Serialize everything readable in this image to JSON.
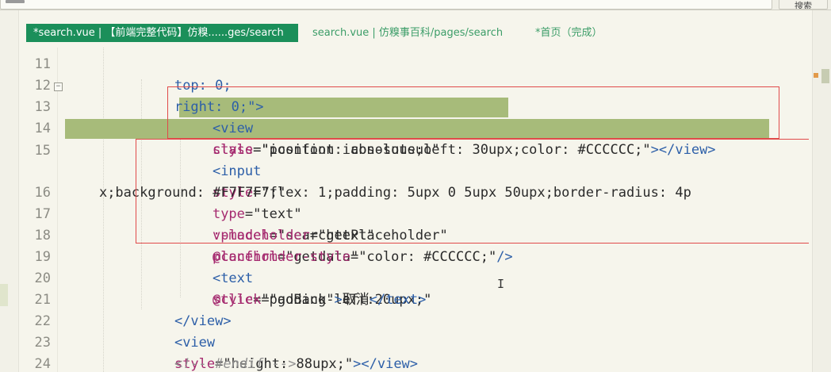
{
  "topbar": {
    "button_label": "搜索"
  },
  "tabs": [
    {
      "label": "*search.vue | 【前端完整代码】仿糗......ges/search",
      "active": true
    },
    {
      "label": "search.vue | 仿糗事百科/pages/search",
      "active": false
    },
    {
      "label": "*首页（完成）",
      "active": false
    }
  ],
  "editor": {
    "line_numbers": [
      "11",
      "12",
      "13",
      "14",
      "15",
      "",
      "16",
      "17",
      "18",
      "19",
      "20",
      "21",
      "22",
      "23",
      "24"
    ],
    "lines": {
      "l11": "top: 0;",
      "l12": "right: 0;\">",
      "l13_tag": "<view",
      "l13_attr": "class",
      "l13_str": "=\"iconfont icon-sousuo\"",
      "l14_attr": "style",
      "l14_str": "=\"position: absolute;left: 30upx;color: #CCCCCC;\"",
      "l14_tag": "></view>",
      "l15_tag": "<input",
      "l15_attr": "style",
      "l15_str": "=\"flex: 1;padding: 5upx 0 5upx 50upx;border-radius: 4p",
      "l15b_str": "x;background: #F7F7F7;\"",
      "l16_attr1": "type",
      "l16_str1": "=\"text\"",
      "l16_attr2": "v-model",
      "l16_str2": "=\"searchtext\"",
      "l16_attr3": "@confirm",
      "l16_str3": "=\"getdata\"",
      "l17_attr": ":placeholder",
      "l17_str": "=\"getPlaceholder\"",
      "l18_attr": "placeholder-style",
      "l18_str": "=\"color: #CCCCCC;\"",
      "l18_tag": "/>",
      "l19_tag": "<text",
      "l19_attr": "style",
      "l19_str": "=\"padding-left:20upx;\"",
      "l20_attr": "@click",
      "l20_str": "=\"goBack\"",
      "l20_tag1": ">",
      "l20_txt": "取消",
      "l20_tag2": "</text>",
      "l21_tag": "</view>",
      "l22_tag": "<view",
      "l22_attr": "style",
      "l22_str": "=\"height: 88upx;\"",
      "l22_tag2": "></view>",
      "l23_cmt": "<!-- #endif -->"
    }
  },
  "colors": {
    "active_tab": "#1b8f5a",
    "selection": "#a7bb7a",
    "annotation_box": "#e04a4a",
    "background": "#f6f5ec"
  }
}
